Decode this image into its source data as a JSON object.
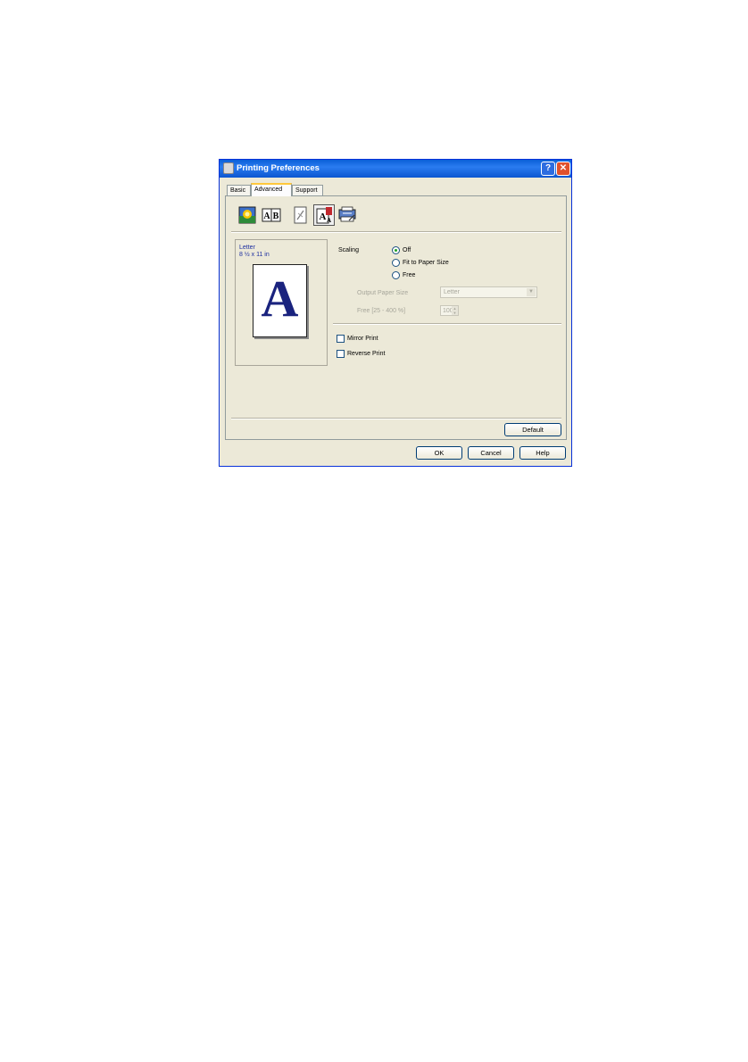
{
  "window": {
    "title": "Printing Preferences",
    "help_glyph": "?",
    "close_glyph": "✕"
  },
  "tabs": [
    {
      "label": "Basic"
    },
    {
      "label": "Advanced"
    },
    {
      "label": "Support"
    }
  ],
  "toolbar_icons": [
    "color-settings-icon",
    "layout-ab-icon",
    "watermark-icon",
    "scaling-icon",
    "device-options-icon"
  ],
  "preview": {
    "paper_name": "Letter",
    "paper_size": "8 ½ x 11 in",
    "page_glyph": "A"
  },
  "scaling": {
    "label": "Scaling",
    "options": [
      {
        "label": "Off",
        "selected": true
      },
      {
        "label": "Fit to Paper Size",
        "selected": false
      },
      {
        "label": "Free",
        "selected": false
      }
    ],
    "output_paper_size_label": "Output Paper Size",
    "output_paper_size_value": "Letter",
    "free_label": "Free [25 - 400 %]",
    "free_value": "100"
  },
  "mirror_print": {
    "label": "Mirror Print",
    "checked": false
  },
  "reverse_print": {
    "label": "Reverse Print",
    "checked": false
  },
  "buttons": {
    "default": "Default",
    "ok": "OK",
    "cancel": "Cancel",
    "help": "Help"
  }
}
